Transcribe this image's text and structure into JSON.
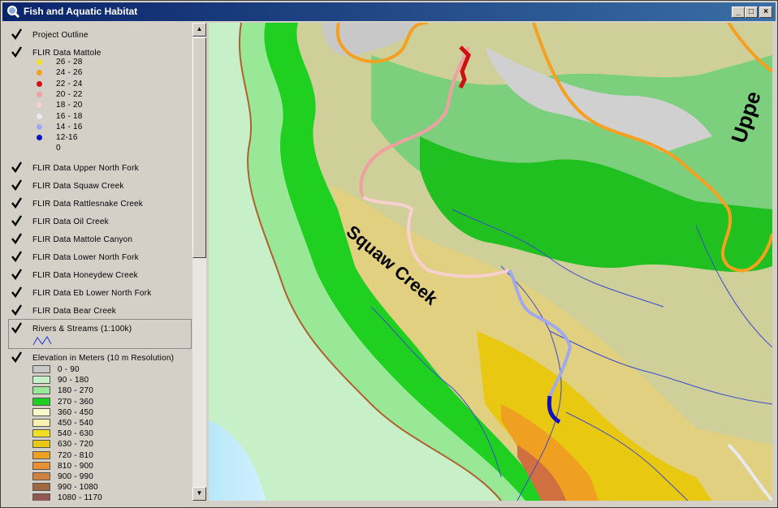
{
  "window": {
    "title": "Fish and Aquatic Habitat"
  },
  "controls": {
    "minimize": "_",
    "maximize": "□",
    "close": "×"
  },
  "toc": {
    "layers": [
      {
        "label": "Project Outline"
      },
      {
        "label": "FLIR Data Mattole"
      },
      {
        "label": "FLIR Data Upper North Fork"
      },
      {
        "label": "FLIR Data Squaw Creek"
      },
      {
        "label": "FLIR Data Rattlesnake Creek"
      },
      {
        "label": "FLIR Data Oil Creek"
      },
      {
        "label": "FLIR Data Mattole Canyon"
      },
      {
        "label": "FLIR Data Lower North Fork"
      },
      {
        "label": "FLIR Data Honeydew Creek"
      },
      {
        "label": "FLIR Data Eb Lower North Fork"
      },
      {
        "label": "FLIR Data Bear Creek"
      },
      {
        "label": "Rivers & Streams (1:100k)"
      },
      {
        "label": "Elevation in Meters (10 m Resolution)"
      }
    ],
    "flir_classes": [
      {
        "label": "26 - 28",
        "color": "#f0e020"
      },
      {
        "label": "24 - 26",
        "color": "#f5a020"
      },
      {
        "label": "22 - 24",
        "color": "#d01010"
      },
      {
        "label": "20 - 22",
        "color": "#f0a0a0"
      },
      {
        "label": "18 - 20",
        "color": "#f8d0d0"
      },
      {
        "label": "16 - 18",
        "color": "#e8e8f0"
      },
      {
        "label": "14 - 16",
        "color": "#a0a8f0"
      },
      {
        "label": "12-16",
        "color": "#1010c0"
      },
      {
        "label": "0",
        "color": ""
      }
    ],
    "elevation_classes": [
      {
        "label": "0 - 90",
        "color": "#c8c8c8"
      },
      {
        "label": "90 - 180",
        "color": "#c8f0c8"
      },
      {
        "label": "180 - 270",
        "color": "#98e898"
      },
      {
        "label": "270 - 360",
        "color": "#20d020"
      },
      {
        "label": "360 - 450",
        "color": "#f8f8c8"
      },
      {
        "label": "450 - 540",
        "color": "#f8f0b0"
      },
      {
        "label": "540 - 630",
        "color": "#f0e020"
      },
      {
        "label": "630 - 720",
        "color": "#e8c810"
      },
      {
        "label": "720 - 810",
        "color": "#f0a020"
      },
      {
        "label": "810 - 900",
        "color": "#e89030"
      },
      {
        "label": "900 - 990",
        "color": "#d08040"
      },
      {
        "label": "990 - 1080",
        "color": "#a06840"
      },
      {
        "label": "1080 - 1170",
        "color": "#905850"
      }
    ]
  },
  "map": {
    "labels": {
      "squaw_creek": "Squaw Creek",
      "upper": "Uppe"
    }
  }
}
